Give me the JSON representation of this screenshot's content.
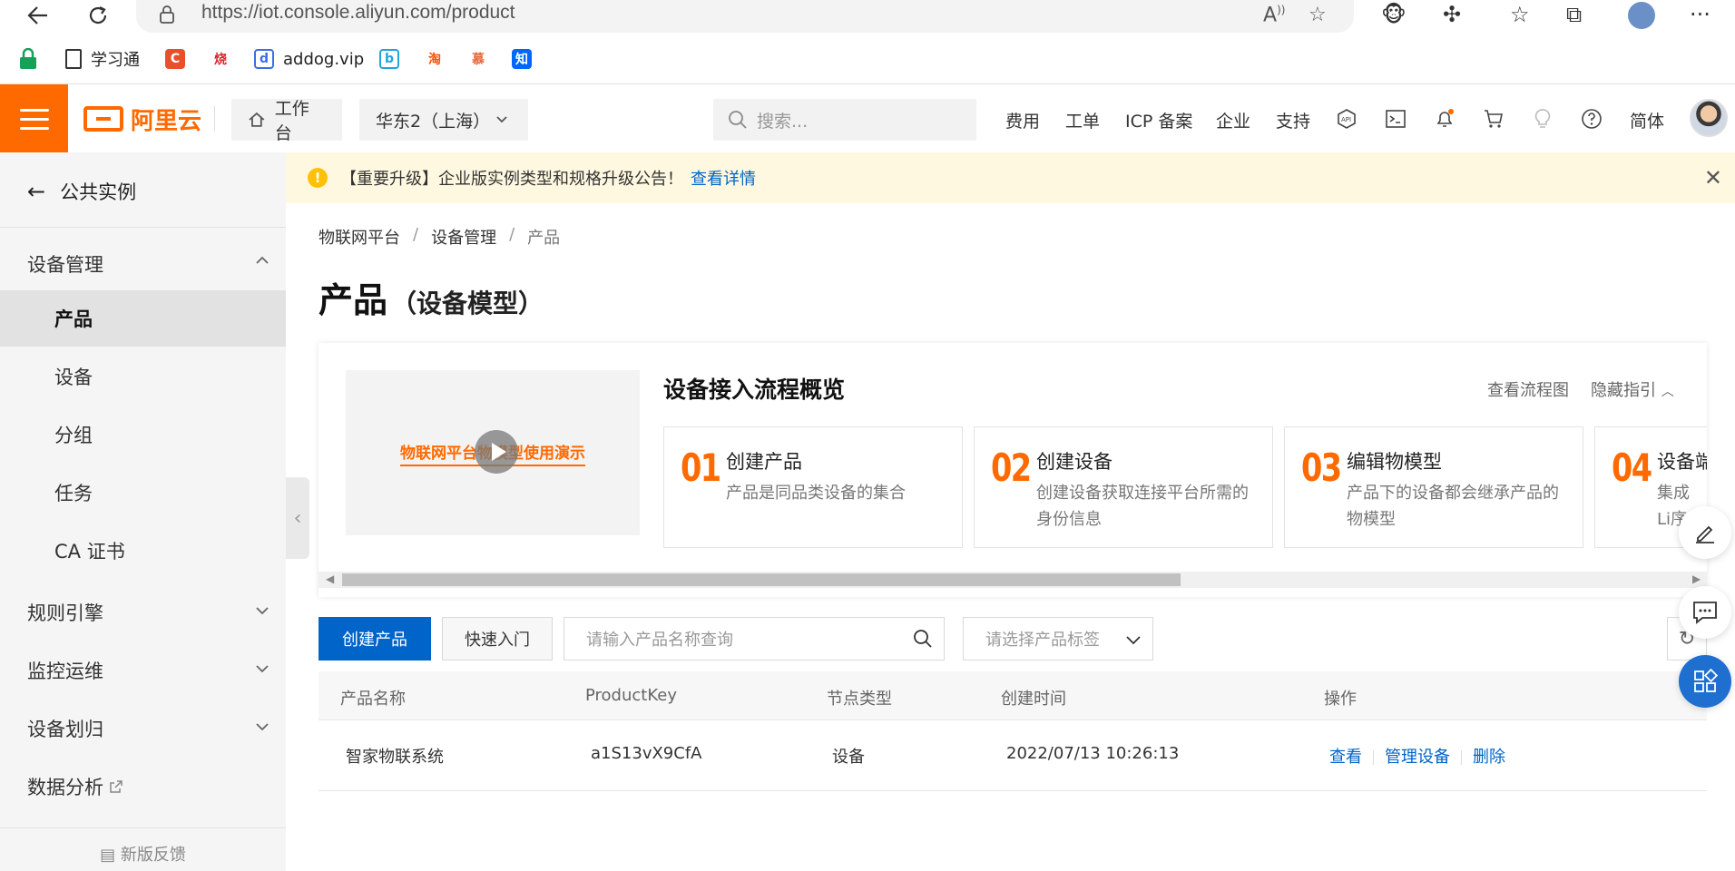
{
  "browser": {
    "url": "https://iot.console.aliyun.com/product",
    "bookmarks": [
      {
        "label": "学习通",
        "icon": "page-icon"
      },
      {
        "label": "",
        "icon": "c-icon",
        "glyph": "C",
        "color": "#e8502c"
      },
      {
        "label": "",
        "icon": "flame-icon",
        "glyph": "烧",
        "color": "#d8262c"
      },
      {
        "label": "addog.vip",
        "icon": "addog-icon",
        "glyph": "d",
        "color": "#3a6ee8"
      },
      {
        "label": "",
        "icon": "bilibili-icon",
        "glyph": "b",
        "color": "#1fa4e0"
      },
      {
        "label": "",
        "icon": "taobao-icon",
        "glyph": "淘",
        "color": "#ff5000"
      },
      {
        "label": "",
        "icon": "mooc-icon",
        "glyph": "慕",
        "color": "#e5693a"
      },
      {
        "label": "",
        "icon": "zhihu-icon",
        "glyph": "知",
        "color": "#0066ff"
      }
    ]
  },
  "header": {
    "logo_text": "阿里云",
    "workbench": "工作台",
    "region": "华东2（上海）",
    "search_placeholder": "搜索...",
    "links": [
      "费用",
      "工单",
      "ICP 备案",
      "企业",
      "支持"
    ],
    "lang": "简体"
  },
  "sidebar": {
    "back_label": "公共实例",
    "group_device": "设备管理",
    "items": [
      "产品",
      "设备",
      "分组",
      "任务",
      "CA 证书"
    ],
    "active_item": "产品",
    "groups": [
      "规则引擎",
      "监控运维",
      "设备划归"
    ],
    "data_analysis": "数据分析",
    "feedback": "新版反馈"
  },
  "notice": {
    "text": "【重要升级】企业版实例类型和规格升级公告！",
    "link": "查看详情"
  },
  "breadcrumb": [
    "物联网平台",
    "设备管理",
    "产品"
  ],
  "page_title": {
    "main": "产品",
    "sub": "（设备模型）"
  },
  "guide": {
    "video_title": "物联网平台物模型使用演示",
    "title": "设备接入流程概览",
    "view_flowchart": "查看流程图",
    "hide_guide": "隐藏指引",
    "steps": [
      {
        "num": "01",
        "title": "创建产品",
        "desc": "产品是同品类设备的集合"
      },
      {
        "num": "02",
        "title": "创建设备",
        "desc": "创建设备获取连接平台所需的身份信息"
      },
      {
        "num": "03",
        "title": "编辑物模型",
        "desc": "产品下的设备都会继承产品的物模型"
      },
      {
        "num": "04",
        "title": "设备端",
        "desc": "集成Li序"
      }
    ]
  },
  "toolbar": {
    "create_label": "创建产品",
    "quickstart_label": "快速入门",
    "search_placeholder": "请输入产品名称查询",
    "tag_placeholder": "请选择产品标签"
  },
  "table": {
    "headers": [
      "产品名称",
      "ProductKey",
      "节点类型",
      "创建时间",
      "操作"
    ],
    "rows": [
      {
        "name": "智家物联系统",
        "product_key": "a1S13vX9CfA",
        "node_type": "设备",
        "created": "2022/07/13 10:26:13",
        "actions": [
          "查看",
          "管理设备",
          "删除"
        ]
      }
    ]
  },
  "colors": {
    "brand_orange": "#ff6a00",
    "primary_blue": "#0064c8",
    "notice_bg": "#fff8e1"
  }
}
